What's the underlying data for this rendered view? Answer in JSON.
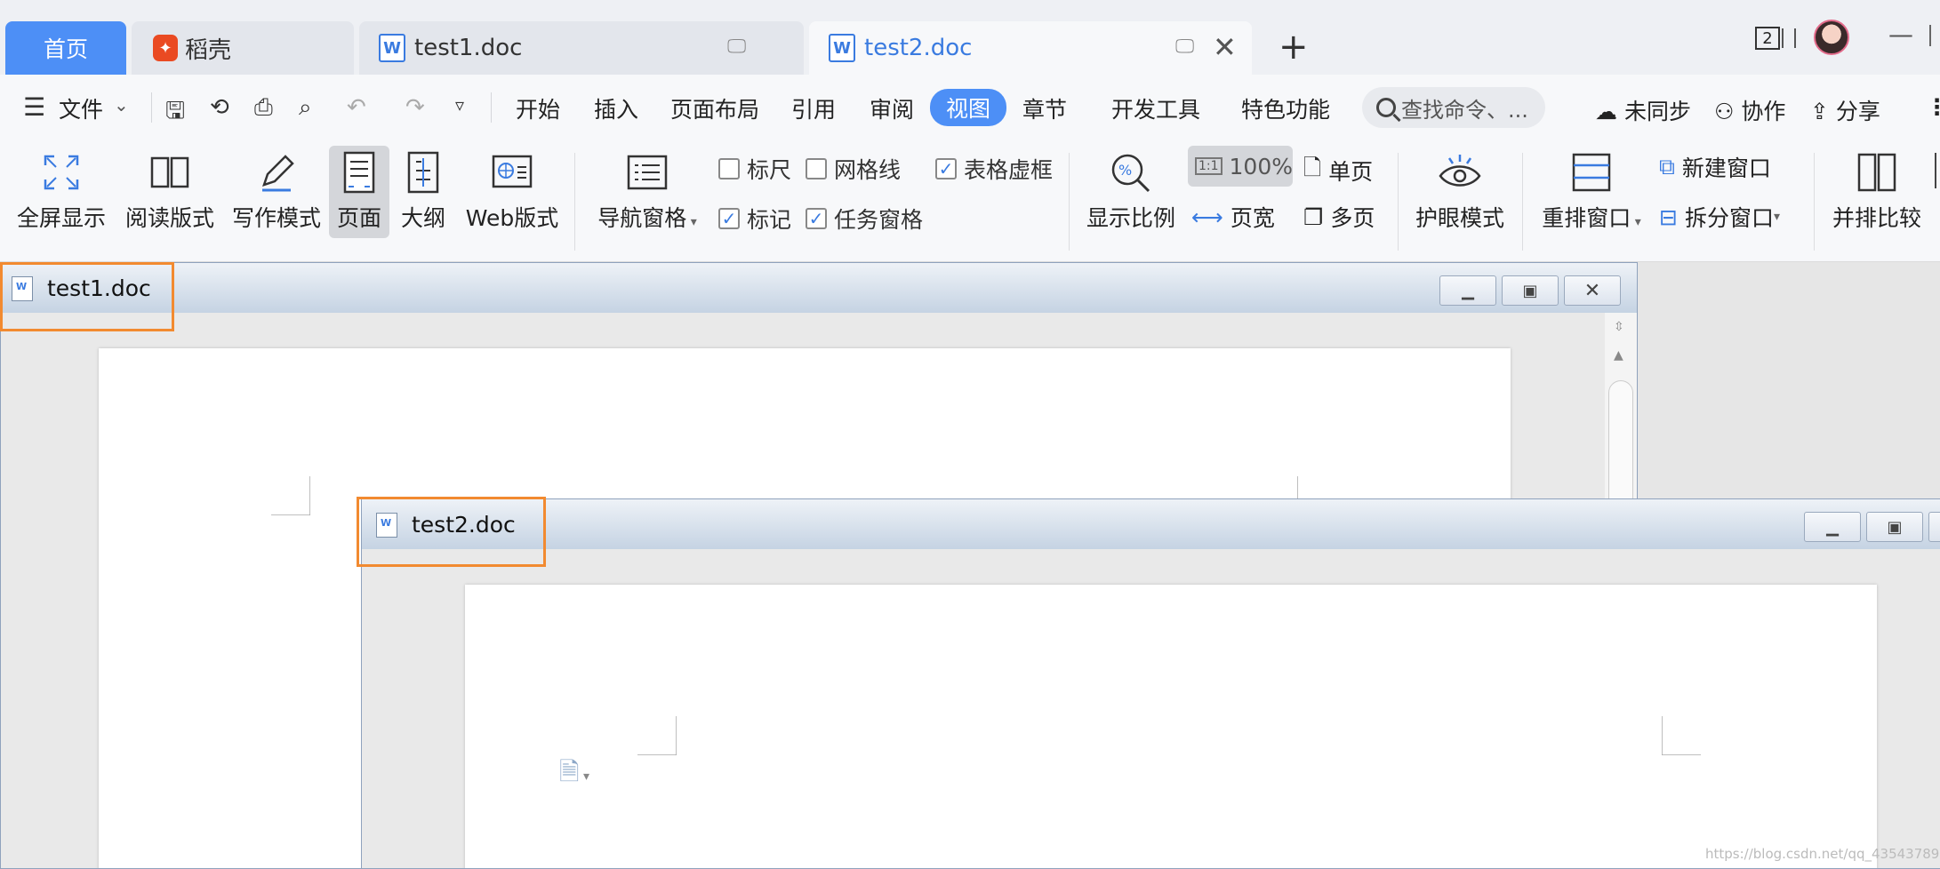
{
  "tabs": {
    "home": "首页",
    "docer": "稻壳",
    "doc1": "test1.doc",
    "doc2": "test2.doc",
    "window_count": "2"
  },
  "menu": {
    "file": "文件",
    "items": [
      "开始",
      "插入",
      "页面布局",
      "引用",
      "审阅",
      "视图",
      "章节",
      "开发工具",
      "特色功能"
    ],
    "search_placeholder": "查找命令、...",
    "sync": "未同步",
    "collab": "协作",
    "share": "分享"
  },
  "ribbon": {
    "fullscreen": "全屏显示",
    "reading": "阅读版式",
    "writing": "写作模式",
    "page": "页面",
    "outline": "大纲",
    "web": "Web版式",
    "nav_pane": "导航窗格",
    "ruler": "标尺",
    "gridlines": "网格线",
    "table_gridlines": "表格虚框",
    "marks": "标记",
    "task_pane": "任务窗格",
    "zoom": "显示比例",
    "zoom_value": "100%",
    "one_to_one": "1:1",
    "page_width": "页宽",
    "single_page": "单页",
    "multi_page": "多页",
    "eye_care": "护眼模式",
    "arrange": "重排窗口",
    "new_window": "新建窗口",
    "split_window": "拆分窗口",
    "side_by_side": "并排比较"
  },
  "checks": {
    "ruler": false,
    "gridlines": false,
    "table_gridlines": true,
    "marks": true,
    "task_pane": true
  },
  "windows": {
    "w1_title": "test1.doc",
    "w2_title": "test2.doc"
  },
  "watermark": "https://blog.csdn.net/qq_43543789",
  "colors": {
    "accent": "#4d8ff6",
    "highlight": "#f28a30",
    "title_blue": "#3a7be0"
  }
}
